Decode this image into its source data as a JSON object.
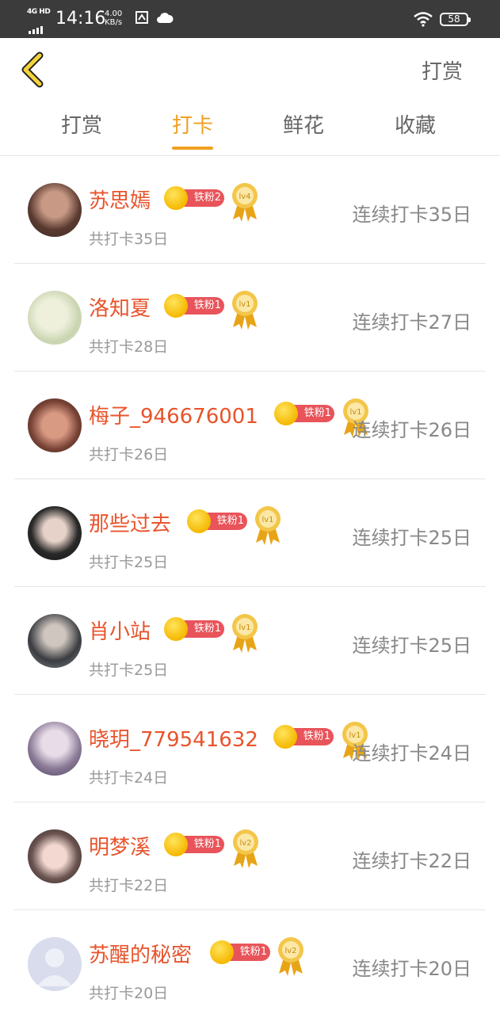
{
  "status_bar": {
    "network": "4G HD",
    "time": "14:16",
    "speed_value": "4.00",
    "speed_unit": "KB/s",
    "battery": "58"
  },
  "header": {
    "back_icon": "chevron-left-icon",
    "action_label": "打赏"
  },
  "tabs": [
    {
      "label": "打赏",
      "active": false
    },
    {
      "label": "打卡",
      "active": true
    },
    {
      "label": "鲜花",
      "active": false
    },
    {
      "label": "收藏",
      "active": false
    }
  ],
  "colors": {
    "accent": "#f0a020",
    "name": "#e8542c",
    "fan_pill": "#e8545a",
    "statusbar": "#3b3b3b"
  },
  "rows": [
    {
      "name": "苏思嫣",
      "fan": "铁粉2",
      "level": "lv4",
      "total": "共打卡35日",
      "streak": "连续打卡35日"
    },
    {
      "name": "洛知夏",
      "fan": "铁粉1",
      "level": "lv1",
      "total": "共打卡28日",
      "streak": "连续打卡27日"
    },
    {
      "name": "梅子_946676001",
      "fan": "铁粉1",
      "level": "lv1",
      "total": "共打卡26日",
      "streak": "连续打卡26日"
    },
    {
      "name": "那些过去",
      "fan": "铁粉1",
      "level": "lv1",
      "total": "共打卡25日",
      "streak": "连续打卡25日"
    },
    {
      "name": "肖小站",
      "fan": "铁粉1",
      "level": "lv1",
      "total": "共打卡25日",
      "streak": "连续打卡25日"
    },
    {
      "name": "晓玥_779541632",
      "fan": "铁粉1",
      "level": "lv1",
      "total": "共打卡24日",
      "streak": "连续打卡24日"
    },
    {
      "name": "明梦溪",
      "fan": "铁粉1",
      "level": "lv2",
      "total": "共打卡22日",
      "streak": "连续打卡22日"
    },
    {
      "name": "苏醒的秘密",
      "fan": "铁粉1",
      "level": "lv2",
      "total": "共打卡20日",
      "streak": "连续打卡20日"
    }
  ]
}
